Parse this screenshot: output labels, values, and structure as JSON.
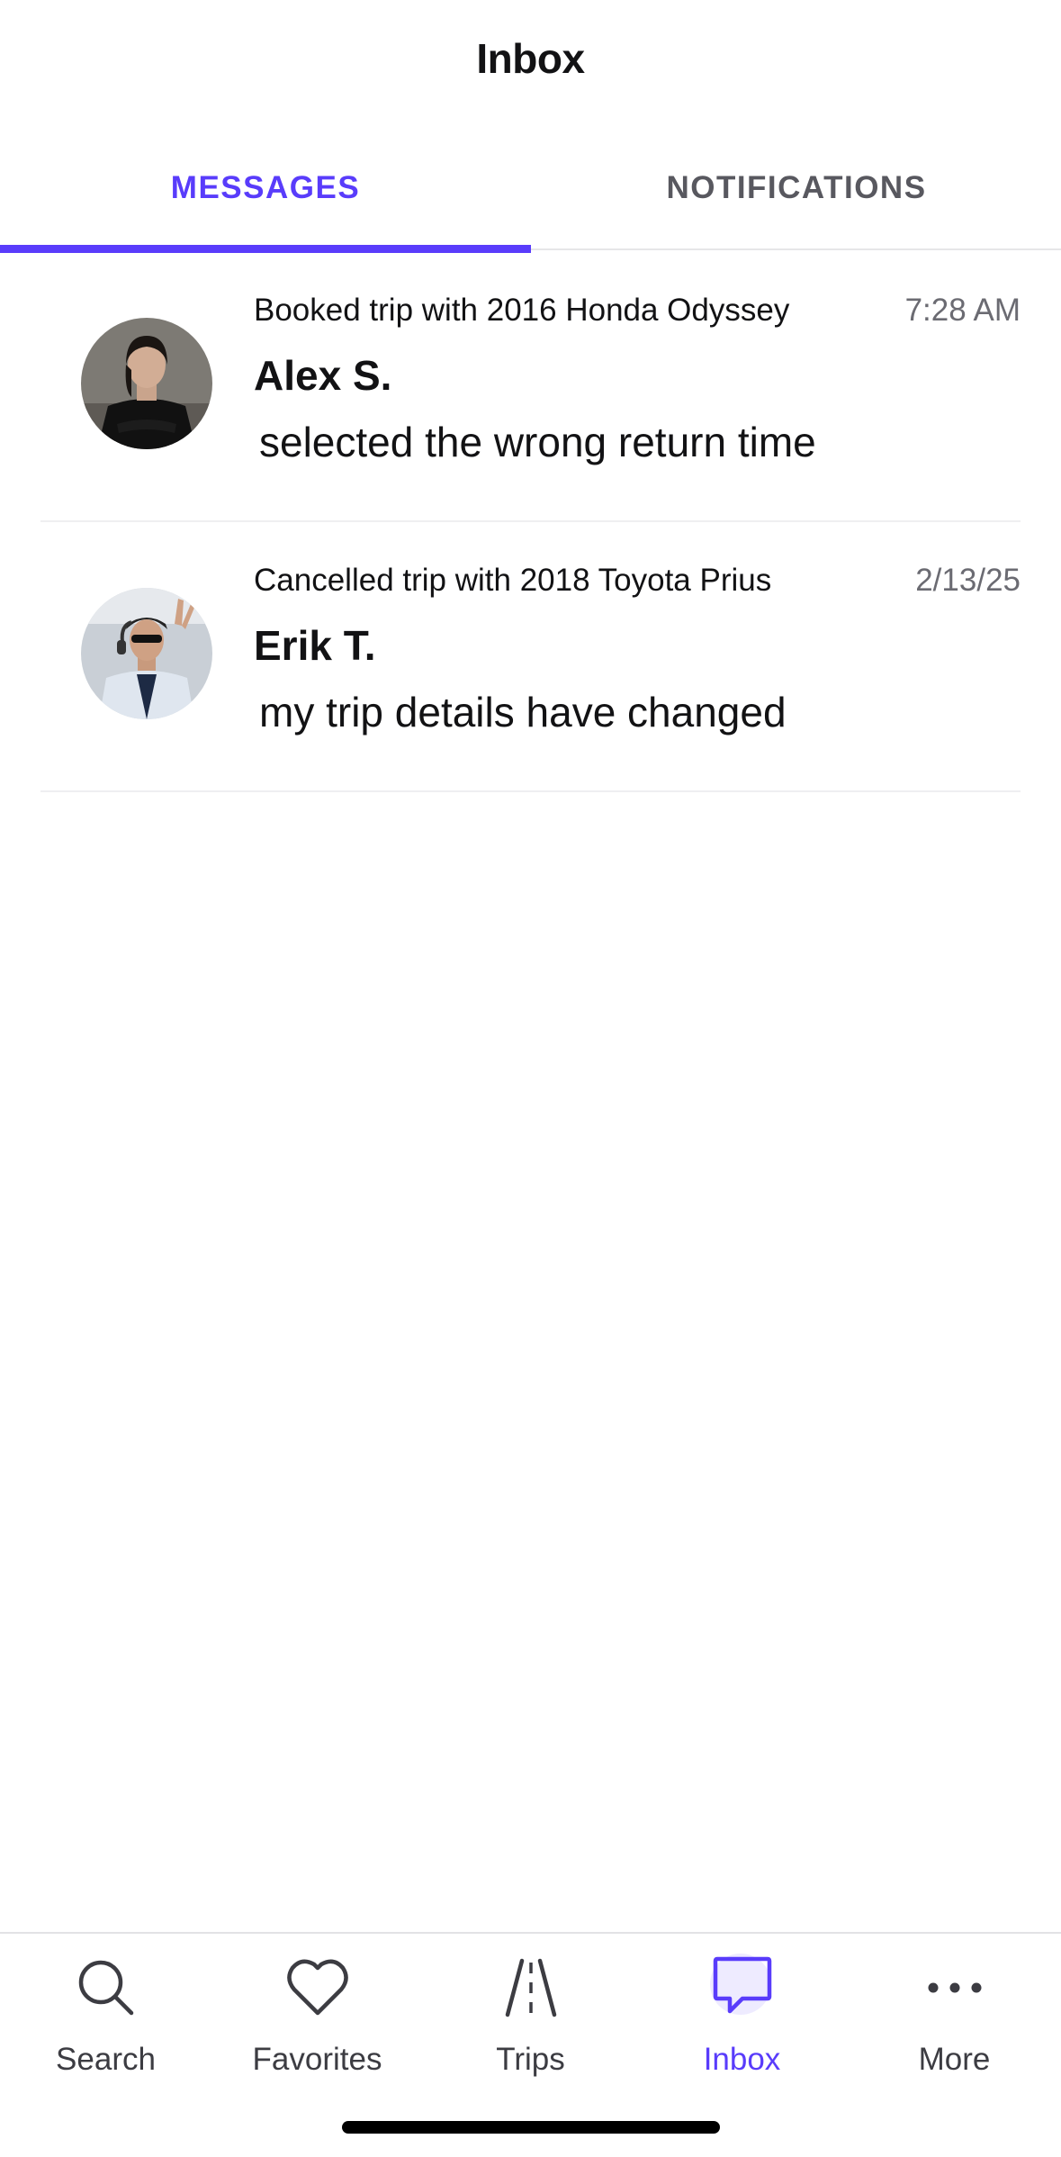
{
  "header": {
    "title": "Inbox"
  },
  "tabs": [
    {
      "label": "MESSAGES",
      "active": true
    },
    {
      "label": "NOTIFICATIONS",
      "active": false
    }
  ],
  "messages": [
    {
      "trip": "Booked trip with 2016 Honda Odyssey",
      "time": "7:28 AM",
      "name": "Alex S.",
      "preview": "selected the wrong return time"
    },
    {
      "trip": "Cancelled trip with 2018 Toyota Prius",
      "time": "2/13/25",
      "name": "Erik T.",
      "preview": "my trip details have changed"
    }
  ],
  "tabbar": {
    "items": [
      {
        "label": "Search",
        "icon": "search-icon"
      },
      {
        "label": "Favorites",
        "icon": "heart-icon"
      },
      {
        "label": "Trips",
        "icon": "road-icon"
      },
      {
        "label": "Inbox",
        "icon": "chat-bubble-icon",
        "active": true
      },
      {
        "label": "More",
        "icon": "more-dots-icon"
      }
    ]
  },
  "colors": {
    "accent": "#593cfb",
    "text": "#121214",
    "muted": "#6b6b72",
    "divider": "#e6e6e8"
  }
}
